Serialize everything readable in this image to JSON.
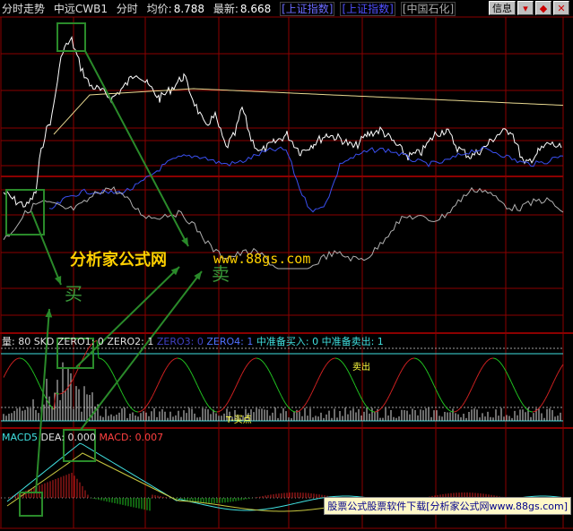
{
  "header": {
    "title": "分时走势",
    "stock_name": "中远CWB1",
    "period": "分时",
    "avg_label": "均价:",
    "avg_value": "8.788",
    "last_label": "最新:",
    "last_value": "8.668",
    "tab_index1": "[上证指数]",
    "tab_index2": "[上证指数]",
    "tab_stock": "[中国石化]"
  },
  "toolbar": {
    "info_label": "信息",
    "minimize_glyph": "▾",
    "restore_glyph": "◆",
    "close_glyph": "✕"
  },
  "panel2": {
    "vol_label": "量: 80",
    "skd_label": "SKD",
    "zero1_label": "ZERO1: 0",
    "zero2_label": "ZERO2: 1",
    "zero3_label": "ZERO3: 0",
    "zero4_label": "ZERO4: 1",
    "buy_label": "中准备买入: 0",
    "sell_label": "中准备卖出: 1",
    "annotation1": "T-买点",
    "annotation2": "卖出"
  },
  "panel3": {
    "macd_label": "MACD5",
    "dea_label": "DEA: 0.000",
    "macd_value_label": "MACD: 0.007"
  },
  "watermark": {
    "site_name": "分析家公式网",
    "url": "www.88gs.com",
    "footer": "股票公式股票软件下载[分析家公式网www.88gs.com]"
  },
  "annotations": {
    "buy": "买",
    "sell": "卖"
  },
  "colors": {
    "grid": "#8b0000",
    "price": "#ffffff",
    "avg": "#e8d890",
    "blue": "#3a4ff0",
    "gray": "#b0b0b0",
    "box": "#2a8a2a",
    "cyan": "#40e0e0",
    "red_line": "#cc2020",
    "green_line": "#20c020"
  }
}
